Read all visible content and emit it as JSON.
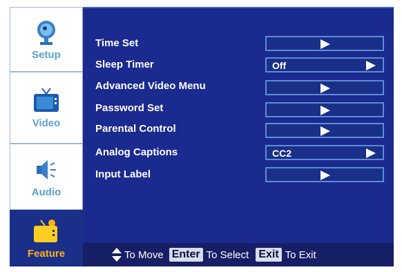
{
  "sidebar": {
    "items": [
      {
        "label": "Setup",
        "icon": "satellite-dish-icon"
      },
      {
        "label": "Video",
        "icon": "tv-icon"
      },
      {
        "label": "Audio",
        "icon": "speaker-icon"
      },
      {
        "label": "Feature",
        "icon": "feature-tv-icon"
      }
    ],
    "active": "Feature"
  },
  "menu": {
    "items": [
      {
        "label": "Time Set",
        "value": ""
      },
      {
        "label": "Sleep Timer",
        "value": "Off"
      },
      {
        "label": "Advanced Video Menu",
        "value": ""
      },
      {
        "label": "Password Set",
        "value": ""
      },
      {
        "label": "Parental Control",
        "value": ""
      },
      {
        "label": "Analog Captions",
        "value": "CC2"
      },
      {
        "label": "Input Label",
        "value": ""
      }
    ]
  },
  "help": {
    "move_text": "To Move",
    "enter_key": "Enter",
    "select_text": "To Select",
    "exit_key": "Exit",
    "exit_text": "To Exit"
  },
  "colors": {
    "panel": "#1a2a8e",
    "field_border": "#5a8ed6",
    "sidebar_label": "#5aa0cc",
    "active_label": "#ffb01a"
  }
}
